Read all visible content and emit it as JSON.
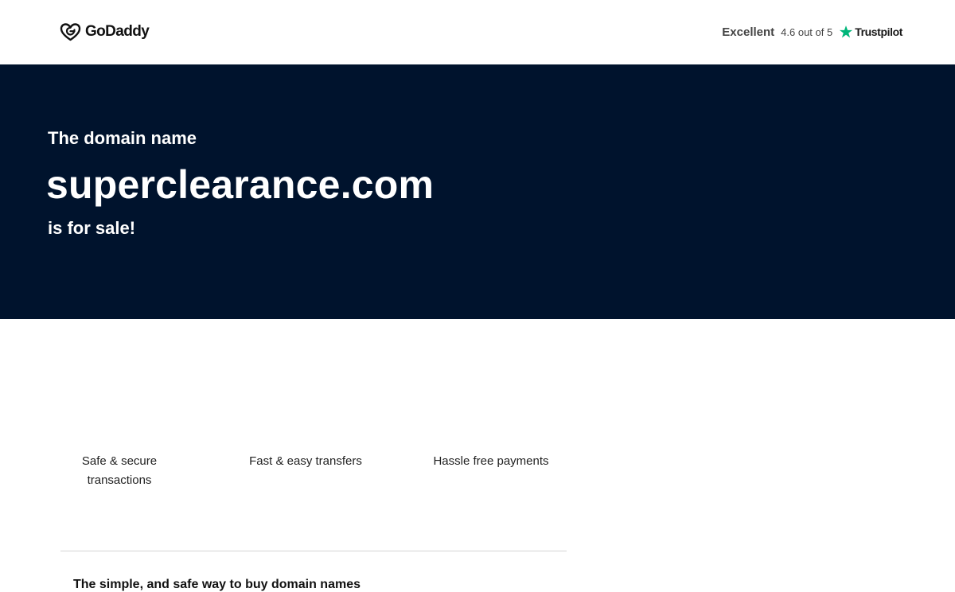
{
  "header": {
    "logo_text": "GoDaddy",
    "rating_word": "Excellent",
    "rating_score": "4.6 out of 5",
    "trustpilot_label": "Trustpilot"
  },
  "hero": {
    "pre_text": "The domain name",
    "domain": "superclearance.com",
    "post_text": "is for sale!"
  },
  "features": [
    {
      "label": "Safe & secure transactions"
    },
    {
      "label": "Fast & easy transfers"
    },
    {
      "label": "Hassle free payments"
    }
  ],
  "section": {
    "heading": "The simple, and safe way to buy domain names"
  },
  "colors": {
    "hero_background": "#00132d",
    "trustpilot_green": "#00b67a",
    "divider": "#d4d4d4"
  },
  "icons": {
    "logo": "godaddy-heart-icon",
    "rating": "trustpilot-star-icon"
  }
}
